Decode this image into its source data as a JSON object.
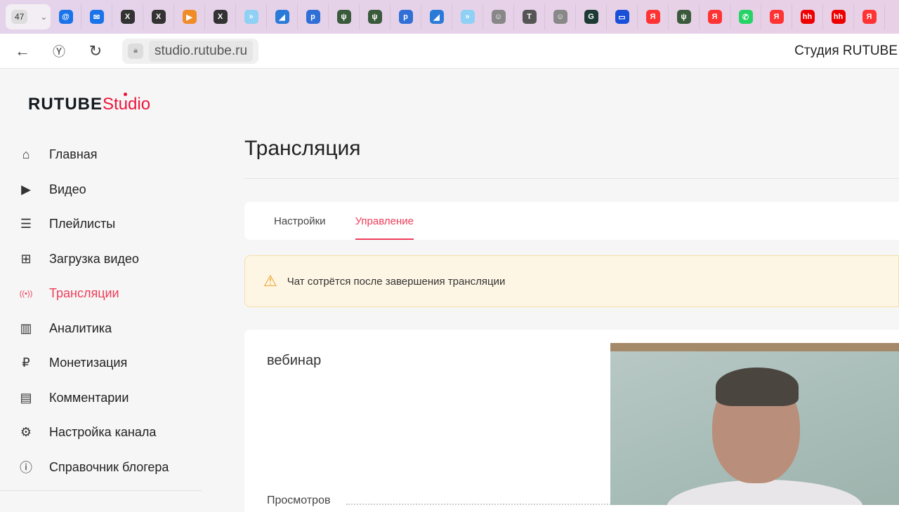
{
  "browser": {
    "tab_count": "47",
    "favicons": [
      {
        "name": "mail-at-icon",
        "color": "#1a73e8",
        "glyph": "@"
      },
      {
        "name": "mail-envelope-icon",
        "color": "#1a73e8",
        "glyph": "✉"
      },
      {
        "name": "x-tab-icon",
        "color": "#333",
        "glyph": "X"
      },
      {
        "name": "x-tab-icon",
        "color": "#333",
        "glyph": "X"
      },
      {
        "name": "play-icon",
        "color": "#f08c28",
        "glyph": "▶"
      },
      {
        "name": "x-tab-icon",
        "color": "#333",
        "glyph": "X"
      },
      {
        "name": "arrows-icon",
        "color": "#8fd0f5",
        "glyph": "»"
      },
      {
        "name": "wave-icon",
        "color": "#2a7ad8",
        "glyph": "◢"
      },
      {
        "name": "p-icon",
        "color": "#2f6fd6",
        "glyph": "p"
      },
      {
        "name": "deer-icon",
        "color": "#3b5a3b",
        "glyph": "ψ"
      },
      {
        "name": "deer-icon",
        "color": "#3b5a3b",
        "glyph": "ψ"
      },
      {
        "name": "p-icon",
        "color": "#2f6fd6",
        "glyph": "p"
      },
      {
        "name": "wave-icon",
        "color": "#2a7ad8",
        "glyph": "◢"
      },
      {
        "name": "arrows-icon",
        "color": "#8fd0f5",
        "glyph": "»"
      },
      {
        "name": "chef-icon",
        "color": "#888",
        "glyph": "☺"
      },
      {
        "name": "t-icon",
        "color": "#555",
        "glyph": "T"
      },
      {
        "name": "chef-icon",
        "color": "#888",
        "glyph": "☺"
      },
      {
        "name": "gc-icon",
        "color": "#1d3a34",
        "glyph": "G"
      },
      {
        "name": "window-icon",
        "color": "#1a4fd8",
        "glyph": "▭"
      },
      {
        "name": "yandex-icon",
        "color": "#f33",
        "glyph": "Я"
      },
      {
        "name": "deer-icon",
        "color": "#3b5a3b",
        "glyph": "ψ"
      },
      {
        "name": "yandex-icon",
        "color": "#f33",
        "glyph": "Я"
      },
      {
        "name": "whatsapp-icon",
        "color": "#25d366",
        "glyph": "✆"
      },
      {
        "name": "yandex-icon",
        "color": "#f33",
        "glyph": "Я"
      },
      {
        "name": "hh-icon",
        "color": "#e00",
        "glyph": "hh"
      },
      {
        "name": "hh-icon",
        "color": "#e00",
        "glyph": "hh"
      },
      {
        "name": "yandex-icon",
        "color": "#f33",
        "glyph": "Я"
      }
    ],
    "url": "studio.rutube.ru",
    "page_title": "Студия RUTUBE"
  },
  "logo": {
    "brand": "RUTUBE",
    "product": "Studio"
  },
  "sidebar": {
    "items": [
      {
        "label": "Главная",
        "icon": "⌂"
      },
      {
        "label": "Видео",
        "icon": "▶"
      },
      {
        "label": "Плейлисты",
        "icon": "☰"
      },
      {
        "label": "Загрузка видео",
        "icon": "⊞"
      },
      {
        "label": "Трансляции",
        "icon": "((•))"
      },
      {
        "label": "Аналитика",
        "icon": "▥"
      },
      {
        "label": "Монетизация",
        "icon": "₽"
      },
      {
        "label": "Комментарии",
        "icon": "▤"
      },
      {
        "label": "Настройка канала",
        "icon": "⚙"
      },
      {
        "label": "Справочник блогера",
        "icon": "ⓘ"
      }
    ]
  },
  "main": {
    "title": "Трансляция",
    "tabs": [
      "Настройки",
      "Управление"
    ],
    "warning": "Чат сотрётся после завершения трансляции",
    "stream_title": "вебинар",
    "views_label": "Просмотров"
  },
  "colors": {
    "accent": "#ed3d5a"
  }
}
